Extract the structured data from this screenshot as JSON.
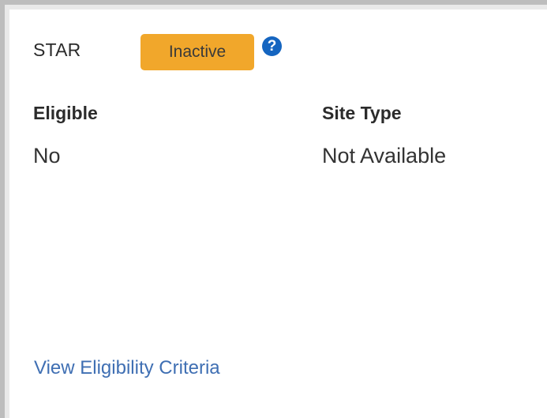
{
  "program": {
    "name": "STAR",
    "status": "Inactive",
    "help_icon": "question-circle-icon"
  },
  "fields": [
    {
      "label": "Eligible",
      "value": "No"
    },
    {
      "label": "Site Type",
      "value": "Not Available"
    }
  ],
  "link": {
    "label": "View Eligibility Criteria"
  },
  "colors": {
    "badge_bg": "#f1a72b",
    "link": "#3f6fb3",
    "help_icon": "#1565c0"
  }
}
